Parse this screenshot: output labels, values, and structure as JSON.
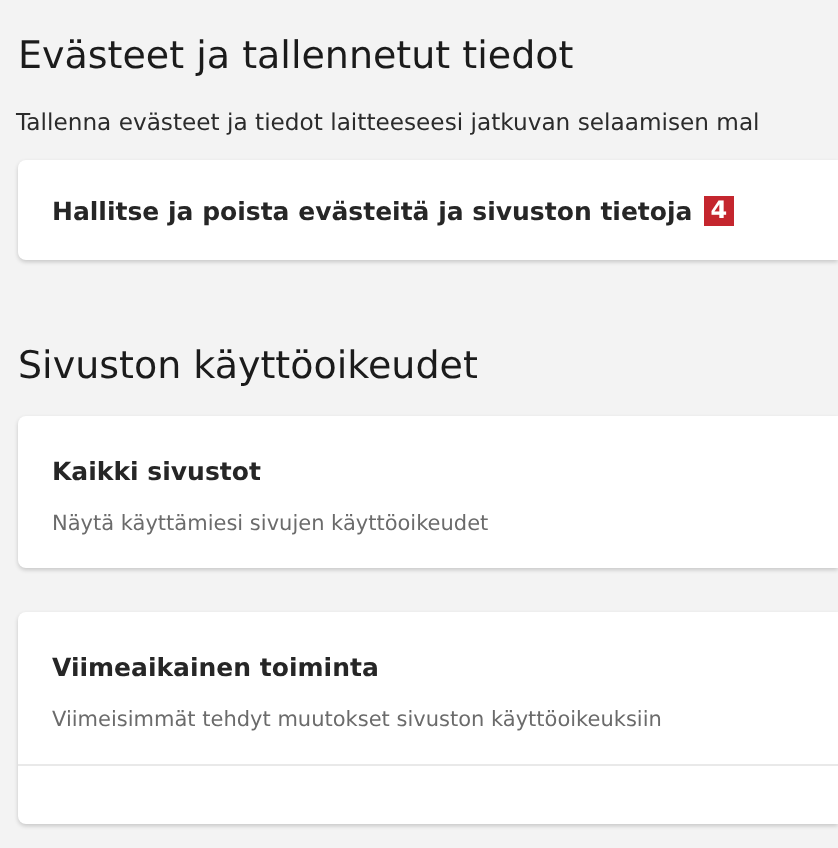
{
  "sections": [
    {
      "title": "Evästeet ja tallennetut tiedot",
      "description": "Tallenna evästeet ja tiedot laitteeseesi jatkuvan selaamisen mal",
      "cards": [
        {
          "items": [
            {
              "title": "Hallitse ja poista evästeitä ja sivuston tietoja",
              "badge": "4"
            }
          ]
        }
      ]
    },
    {
      "title": "Sivuston käyttöoikeudet",
      "cards": [
        {
          "items": [
            {
              "title": "Kaikki sivustot",
              "subtitle": "Näytä käyttämiesi sivujen käyttöoikeudet"
            }
          ]
        },
        {
          "items": [
            {
              "title": "Viimeaikainen toiminta",
              "subtitle": "Viimeisimmät tehdyt muutokset sivuston käyttöoikeuksiin"
            }
          ],
          "more_below": true
        }
      ]
    }
  ]
}
